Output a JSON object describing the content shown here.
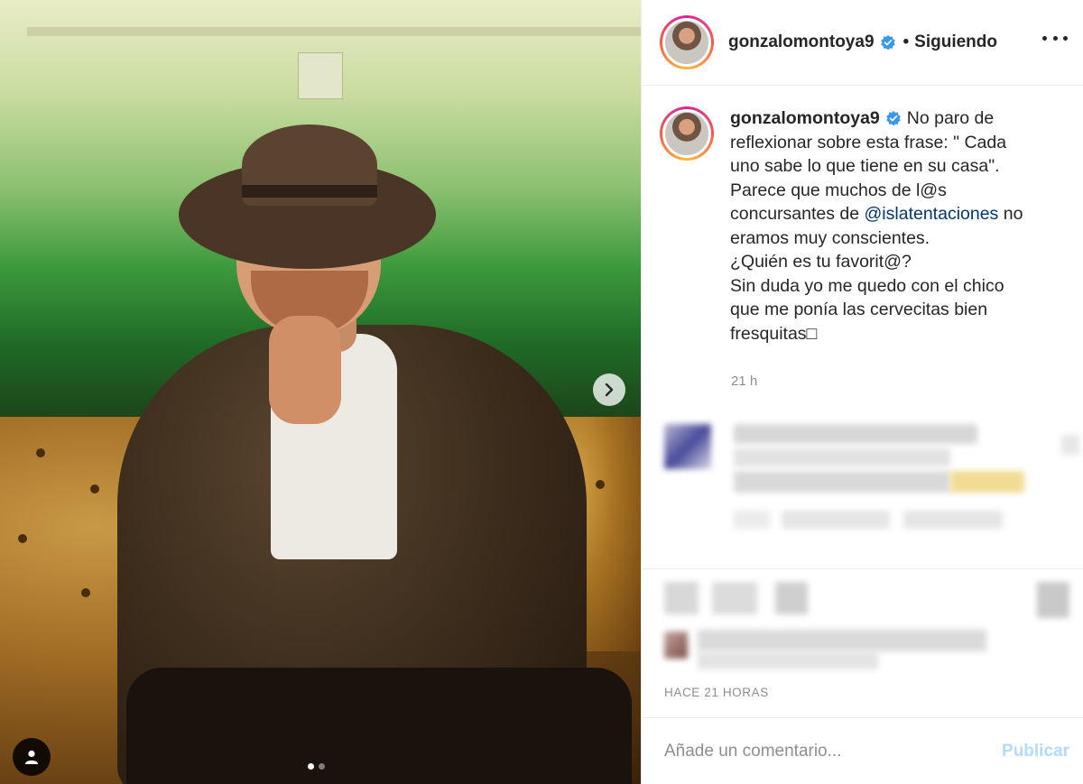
{
  "post": {
    "username": "gonzalomontoya9",
    "separator": "•",
    "follow_status": "Siguiendo",
    "more_icon": "more-options-icon",
    "verified_icon": "verified-badge-icon",
    "caption_lines": [
      "No paro de",
      "reflexionar sobre esta frase: \" Cada",
      "uno sabe lo que tiene en su casa\".",
      "Parece que muchos de l@s",
      "concursantes de ",
      "eramos muy conscientes.",
      "¿Quién es tu favorit@?",
      "Sin duda yo me quedo con el chico",
      "que me ponía las cervecitas bien",
      "fresquitas□"
    ],
    "mention": "@islatentaciones",
    "mention_suffix": " no",
    "caption_age": "21 h",
    "time_label": "HACE 21 HORAS"
  },
  "media": {
    "next_icon": "chevron-right-icon",
    "tag_icon": "user-tag-icon",
    "carousel_count": 2,
    "carousel_active": 1
  },
  "comment_box": {
    "placeholder": "Añade un comentario...",
    "publish_label": "Publicar"
  },
  "colors": {
    "link": "#00376b",
    "muted": "#8e8e8e",
    "publish_disabled": "#b3dbff",
    "verified": "#3897f0"
  }
}
